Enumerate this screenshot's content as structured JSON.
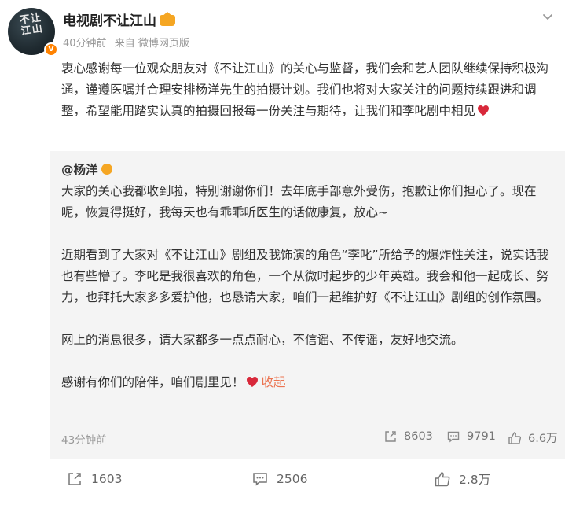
{
  "post": {
    "username": "电视剧不让江山",
    "avatar_text": "不让江山",
    "time": "40分钟前",
    "source": "来自 微博网页版",
    "text": "衷心感谢每一位观众朋友对《不让江山》的关心与监督，我们会和艺人团队继续保持积极沟通，谨遵医嘱并合理安排杨洋先生的拍摄计划。我们也将对大家关注的问题持续跟进和调整，希望能用踏实认真的拍摄回报每一份关注与期待，让我们和李叱剧中相见"
  },
  "repost": {
    "author": "@杨洋",
    "paragraphs": [
      "大家的关心我都收到啦，特别谢谢你们！去年底手部意外受伤，抱歉让你们担心了。现在呢，恢复得挺好，我每天也有乖乖听医生的话做康复，放心~",
      "近期看到了大家对《不让江山》剧组及我饰演的角色“李叱”所给予的爆炸性关注，说实话我也有些懵了。李叱是我很喜欢的角色，一个从微时起步的少年英雄。我会和他一起成长、努力，也拜托大家多多爱护他，也恳请大家，咱们一起维护好《不让江山》剧组的创作氛围。",
      "网上的消息很多，请大家都多一点点耐心，不信谣、不传谣，友好地交流。",
      "感谢有你们的陪伴，咱们剧里见！"
    ],
    "collapse_label": "收起",
    "time": "43分钟前",
    "reposts": "8603",
    "comments": "9791",
    "likes": "6.6万"
  },
  "actions": {
    "reposts": "1603",
    "comments": "2506",
    "likes": "2.8万"
  },
  "colors": {
    "link": "#eb7350",
    "heart": "#d8283a",
    "badge": "#f5a623",
    "verify": "#ff8200"
  }
}
